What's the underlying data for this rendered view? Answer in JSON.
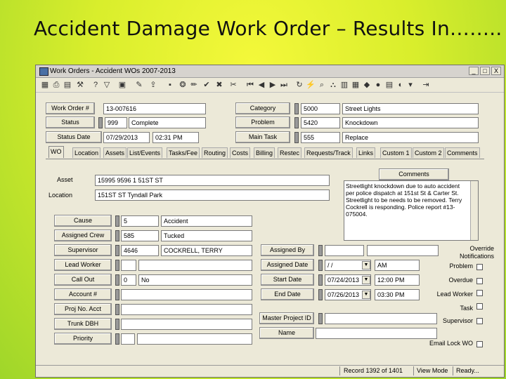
{
  "slide": {
    "title": "Accident Damage Work Order – Results In…….."
  },
  "window": {
    "title": "Work Orders - Accident WOs 2007-2013",
    "minimize": "_",
    "maximize": "□",
    "close": "X"
  },
  "header": {
    "work_order_label": "Work Order #",
    "work_order_value": "13-007616",
    "status_label": "Status",
    "status_code": "999",
    "status_text": "Complete",
    "status_date_label": "Status Date",
    "status_date": "07/29/2013",
    "status_time": "02:31 PM",
    "category_label": "Category",
    "category_code": "5000",
    "category_text": "Street Lights",
    "problem_label": "Problem",
    "problem_code": "5420",
    "problem_text": "Knockdown",
    "main_task_label": "Main Task",
    "main_task_code": "555",
    "main_task_text": "Replace"
  },
  "tabs": [
    "WO",
    "Location",
    "Assets",
    "List/Events",
    "Tasks/Fee",
    "Routing",
    "Costs",
    "Billing",
    "Restec",
    "Requests/Track",
    "Links",
    "Custom 1",
    "Custom 2",
    "Comments"
  ],
  "wo_tab": {
    "asset_label": "Asset",
    "asset_value": "15995 9596 1 51ST ST",
    "location_label": "Location",
    "location_value": "151ST ST Tyndall Park",
    "comments_button": "Comments",
    "comments_text": "Streetlight knockdown due to auto accident per police dispatch at 151st St & Carter St. Streetlight to be needs to be removed. Terry Cockrell is responding. Police report #13-075004.",
    "cause_label": "Cause",
    "cause_code": "5",
    "cause_text": "Accident",
    "assigned_crew_label": "Assigned Crew",
    "assigned_crew_code": "585",
    "assigned_crew_text": "Tucked",
    "supervisor_label": "Supervisor",
    "supervisor_code": "4646",
    "supervisor_text": "COCKRELL, TERRY",
    "lead_worker_label": "Lead Worker",
    "lead_worker_value": "",
    "call_out_label": "Call Out",
    "call_out_code": "0",
    "call_out_text": "No",
    "account_label": "Account #",
    "account_value": "",
    "proj_acct_label": "Proj No. Acct",
    "proj_acct_value": "",
    "trunk_dbh_label": "Trunk DBH",
    "trunk_dbh_value": "",
    "priority_label": "Priority",
    "priority_value": "",
    "assigned_by_label": "Assigned By",
    "assigned_by_value": "",
    "assigned_date_label": "Assigned Date",
    "assigned_date_value": "/ /",
    "assigned_time_value": "AM",
    "start_date_label": "Start Date",
    "start_date_value": "07/24/2013",
    "start_time_value": "12:00 PM",
    "end_date_label": "End Date",
    "end_date_value": "07/26/2013",
    "end_time_value": "03:30 PM",
    "master_project_label": "Master Project ID",
    "master_project_value": "",
    "name_label": "Name",
    "name_value": "",
    "override_title": "Override Notifications",
    "override_items": [
      "Problem",
      "Overdue",
      "Lead Worker",
      "Task",
      "Supervisor"
    ],
    "email_lock_label": "Email Lock WO"
  },
  "status_bar": {
    "record": "Record 1392 of 1401",
    "mode": "View Mode",
    "ready": "Ready..."
  },
  "colors": {
    "slide_bg": "#d9ee2c",
    "window_bg": "#ece9d8"
  }
}
